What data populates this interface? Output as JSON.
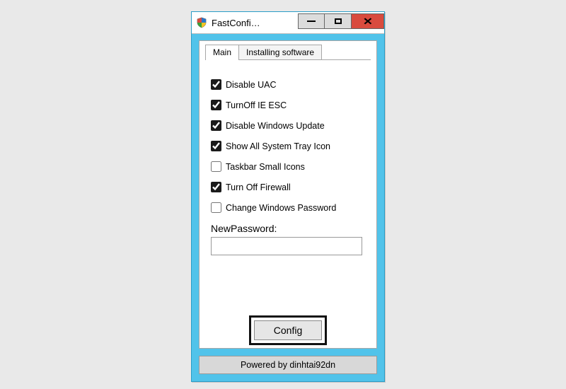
{
  "titlebar": {
    "title": "FastConfi…",
    "icon": "shield-icon"
  },
  "tabs": [
    {
      "label": "Main",
      "active": true
    },
    {
      "label": "Installing software",
      "active": false
    }
  ],
  "options": [
    {
      "label": "Disable UAC",
      "checked": true
    },
    {
      "label": "TurnOff IE ESC",
      "checked": true
    },
    {
      "label": "Disable Windows Update",
      "checked": true
    },
    {
      "label": "Show All System Tray Icon",
      "checked": true
    },
    {
      "label": "Taskbar Small Icons",
      "checked": false
    },
    {
      "label": "Turn Off Firewall",
      "checked": true
    },
    {
      "label": "Change Windows Password",
      "checked": false
    }
  ],
  "password": {
    "label": "NewPassword:",
    "value": ""
  },
  "config_button": "Config",
  "footer": "Powered by dinhtai92dn"
}
